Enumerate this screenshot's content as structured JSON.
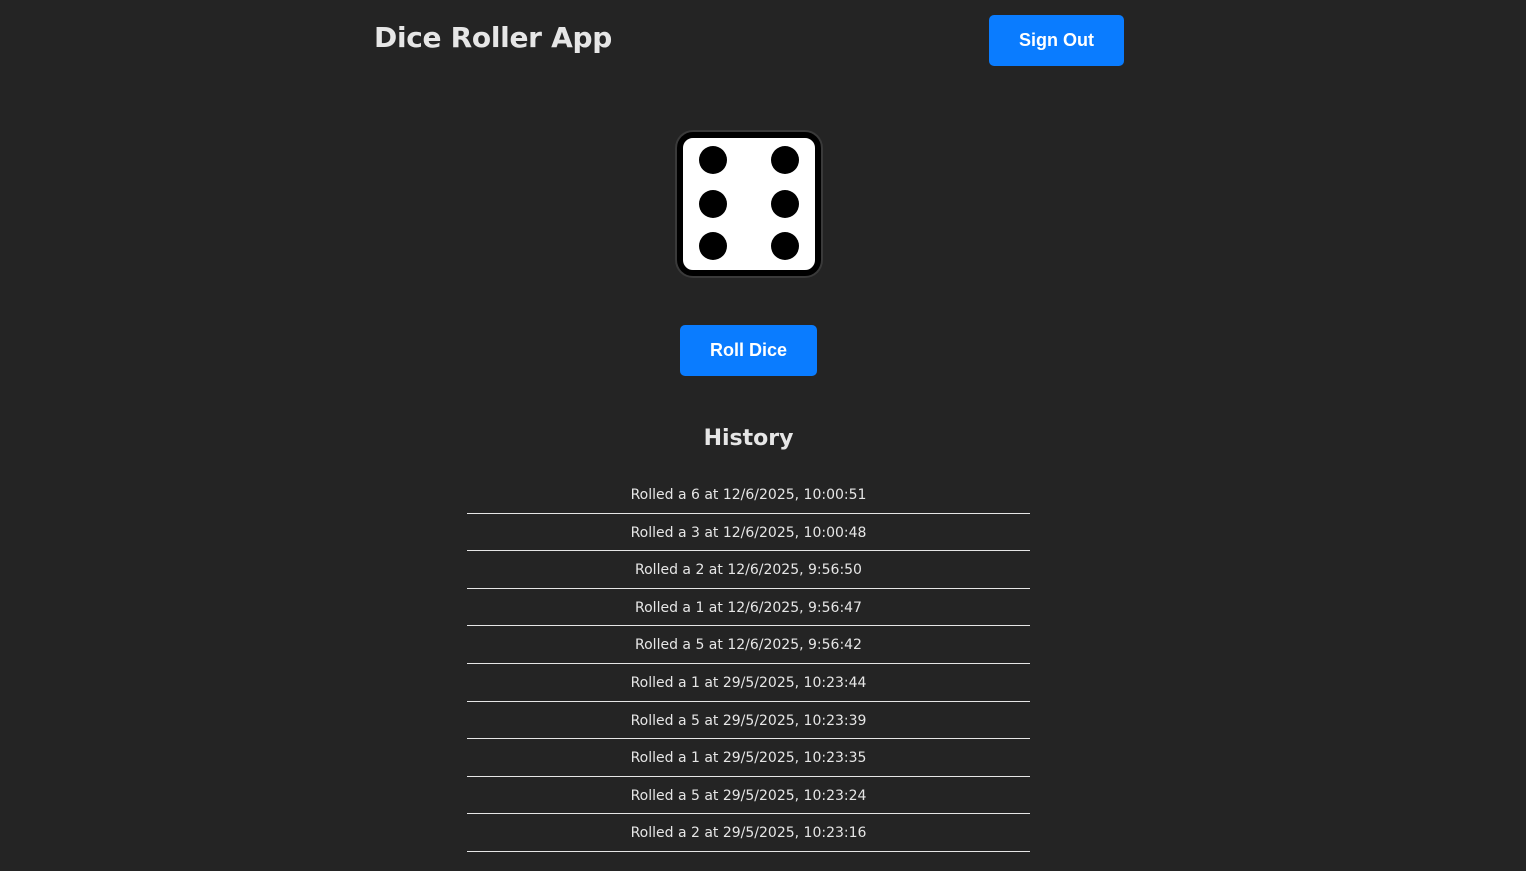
{
  "header": {
    "title": "Dice Roller App",
    "signout_label": "Sign Out"
  },
  "dice": {
    "value": 6
  },
  "roll_button_label": "Roll Dice",
  "history": {
    "title": "History",
    "items": [
      "Rolled a 6 at 12/6/2025, 10:00:51",
      "Rolled a 3 at 12/6/2025, 10:00:48",
      "Rolled a 2 at 12/6/2025, 9:56:50",
      "Rolled a 1 at 12/6/2025, 9:56:47",
      "Rolled a 5 at 12/6/2025, 9:56:42",
      "Rolled a 1 at 29/5/2025, 10:23:44",
      "Rolled a 5 at 29/5/2025, 10:23:39",
      "Rolled a 1 at 29/5/2025, 10:23:35",
      "Rolled a 5 at 29/5/2025, 10:23:24",
      "Rolled a 2 at 29/5/2025, 10:23:16"
    ]
  },
  "colors": {
    "background": "#242424",
    "accent": "#0a7cff",
    "text": "#e6e6e6"
  }
}
